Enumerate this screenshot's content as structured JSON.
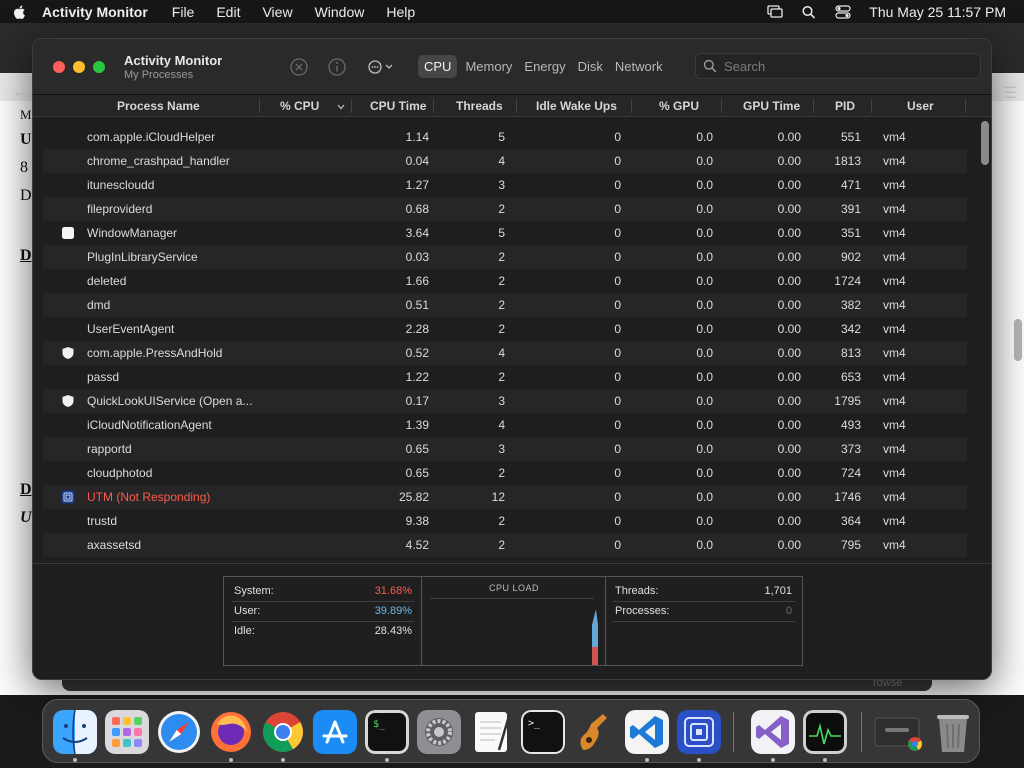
{
  "menubar": {
    "app_name": "Activity Monitor",
    "items": [
      "File",
      "Edit",
      "View",
      "Window",
      "Help"
    ],
    "clock": "Thu May 25  11:57 PM"
  },
  "window": {
    "title": "Activity Monitor",
    "subtitle": "My Processes",
    "tabs": [
      {
        "label": "CPU",
        "active": true
      },
      {
        "label": "Memory",
        "active": false
      },
      {
        "label": "Energy",
        "active": false
      },
      {
        "label": "Disk",
        "active": false
      },
      {
        "label": "Network",
        "active": false
      }
    ],
    "search_placeholder": "Search"
  },
  "table": {
    "columns": [
      "Process Name",
      "% CPU",
      "CPU Time",
      "Threads",
      "Idle Wake Ups",
      "% GPU",
      "GPU Time",
      "PID",
      "User"
    ],
    "sort_column": "% CPU",
    "rows": [
      {
        "icon": "none",
        "name": "com.apple.iCloudHelper",
        "cpu_time": "1.14",
        "threads": "5",
        "idle": "0",
        "gpu": "0.0",
        "gpu_time": "0.00",
        "pid": "551",
        "user": "vm4"
      },
      {
        "icon": "none",
        "name": "chrome_crashpad_handler",
        "cpu_time": "0.04",
        "threads": "4",
        "idle": "0",
        "gpu": "0.0",
        "gpu_time": "0.00",
        "pid": "1813",
        "user": "vm4"
      },
      {
        "icon": "none",
        "name": "itunescloudd",
        "cpu_time": "1.27",
        "threads": "3",
        "idle": "0",
        "gpu": "0.0",
        "gpu_time": "0.00",
        "pid": "471",
        "user": "vm4"
      },
      {
        "icon": "none",
        "name": "fileproviderd",
        "cpu_time": "0.68",
        "threads": "2",
        "idle": "0",
        "gpu": "0.0",
        "gpu_time": "0.00",
        "pid": "391",
        "user": "vm4"
      },
      {
        "icon": "window-icon",
        "name": "WindowManager",
        "cpu_time": "3.64",
        "threads": "5",
        "idle": "0",
        "gpu": "0.0",
        "gpu_time": "0.00",
        "pid": "351",
        "user": "vm4"
      },
      {
        "icon": "none",
        "name": "PlugInLibraryService",
        "cpu_time": "0.03",
        "threads": "2",
        "idle": "0",
        "gpu": "0.0",
        "gpu_time": "0.00",
        "pid": "902",
        "user": "vm4"
      },
      {
        "icon": "none",
        "name": "deleted",
        "cpu_time": "1.66",
        "threads": "2",
        "idle": "0",
        "gpu": "0.0",
        "gpu_time": "0.00",
        "pid": "1724",
        "user": "vm4"
      },
      {
        "icon": "none",
        "name": "dmd",
        "cpu_time": "0.51",
        "threads": "2",
        "idle": "0",
        "gpu": "0.0",
        "gpu_time": "0.00",
        "pid": "382",
        "user": "vm4"
      },
      {
        "icon": "none",
        "name": "UserEventAgent",
        "cpu_time": "2.28",
        "threads": "2",
        "idle": "0",
        "gpu": "0.0",
        "gpu_time": "0.00",
        "pid": "342",
        "user": "vm4"
      },
      {
        "icon": "shield-icon",
        "name": "com.apple.PressAndHold",
        "cpu_time": "0.52",
        "threads": "4",
        "idle": "0",
        "gpu": "0.0",
        "gpu_time": "0.00",
        "pid": "813",
        "user": "vm4"
      },
      {
        "icon": "none",
        "name": "passd",
        "cpu_time": "1.22",
        "threads": "2",
        "idle": "0",
        "gpu": "0.0",
        "gpu_time": "0.00",
        "pid": "653",
        "user": "vm4"
      },
      {
        "icon": "shield-icon",
        "name": "QuickLookUIService (Open a...",
        "cpu_time": "0.17",
        "threads": "3",
        "idle": "0",
        "gpu": "0.0",
        "gpu_time": "0.00",
        "pid": "1795",
        "user": "vm4"
      },
      {
        "icon": "none",
        "name": "iCloudNotificationAgent",
        "cpu_time": "1.39",
        "threads": "4",
        "idle": "0",
        "gpu": "0.0",
        "gpu_time": "0.00",
        "pid": "493",
        "user": "vm4"
      },
      {
        "icon": "none",
        "name": "rapportd",
        "cpu_time": "0.65",
        "threads": "3",
        "idle": "0",
        "gpu": "0.0",
        "gpu_time": "0.00",
        "pid": "373",
        "user": "vm4"
      },
      {
        "icon": "none",
        "name": "cloudphotod",
        "cpu_time": "0.65",
        "threads": "2",
        "idle": "0",
        "gpu": "0.0",
        "gpu_time": "0.00",
        "pid": "724",
        "user": "vm4"
      },
      {
        "icon": "utm-icon",
        "name": "UTM (Not Responding)",
        "cpu_time": "25.82",
        "threads": "12",
        "idle": "0",
        "gpu": "0.0",
        "gpu_time": "0.00",
        "pid": "1746",
        "user": "vm4",
        "not_responding": true
      },
      {
        "icon": "none",
        "name": "trustd",
        "cpu_time": "9.38",
        "threads": "2",
        "idle": "0",
        "gpu": "0.0",
        "gpu_time": "0.00",
        "pid": "364",
        "user": "vm4"
      },
      {
        "icon": "none",
        "name": "axassetsd",
        "cpu_time": "4.52",
        "threads": "2",
        "idle": "0",
        "gpu": "0.0",
        "gpu_time": "0.00",
        "pid": "795",
        "user": "vm4"
      }
    ]
  },
  "stats": {
    "system_label": "System:",
    "system_value": "31.68%",
    "user_label": "User:",
    "user_value": "39.89%",
    "idle_label": "Idle:",
    "idle_value": "28.43%",
    "cpu_load_title": "CPU LOAD",
    "threads_label": "Threads:",
    "threads_value": "1,701",
    "processes_label": "Processes:",
    "processes_value": "0"
  },
  "background": {
    "letters": [
      "M",
      "U",
      "8",
      "D",
      "D",
      "D",
      "U"
    ],
    "browse_text": "rowse"
  },
  "colors": {
    "system": "#ff5a4f",
    "user": "#6ab7e8",
    "not_responding": "#ff5a4f",
    "accent": "#464646"
  },
  "dock": {
    "apps": [
      "finder-icon",
      "launchpad-icon",
      "safari-icon",
      "firefox-icon",
      "chrome-icon",
      "app-store-icon",
      "terminal-icon",
      "system-settings-icon",
      "textedit-icon",
      "terminal-dark-icon",
      "garageband-icon",
      "vscode-icon",
      "utm-icon",
      "visual-studio-icon",
      "activity-monitor-icon",
      "chrome-window-icon",
      "trash-icon"
    ]
  }
}
